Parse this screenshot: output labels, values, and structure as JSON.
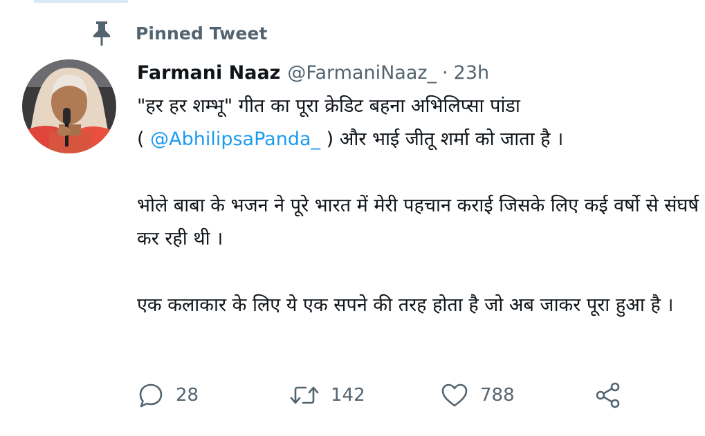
{
  "pinned": {
    "label": "Pinned Tweet",
    "icon": "pin-icon"
  },
  "author": {
    "name": "Farmani Naaz",
    "handle": "@FarmaniNaaz_",
    "separator": "·",
    "time": "23h"
  },
  "tweet": {
    "line1": "\"हर हर शम्भू\" गीत का पूरा क्रेडिट बहना अभिलिप्सा पांडा",
    "line2_open": "( ",
    "mention": "@AbhilipsaPanda_",
    "line2_close": " ) और भाई जीतू शर्मा को जाता है ।",
    "para2": "भोले बाबा के भजन ने पूरे भारत में मेरी पहचान कराई जिसके लिए कई वर्षो से संघर्ष कर रही थी ।",
    "para3": "एक कलाकार के लिए ये एक सपने की तरह होता है जो अब जाकर पूरा हुआ है ।"
  },
  "actions": {
    "reply_count": "28",
    "retweet_count": "142",
    "like_count": "788"
  },
  "colors": {
    "mention": "#1d9bf0",
    "secondary_text": "#536471",
    "primary_text": "#0f1419"
  }
}
